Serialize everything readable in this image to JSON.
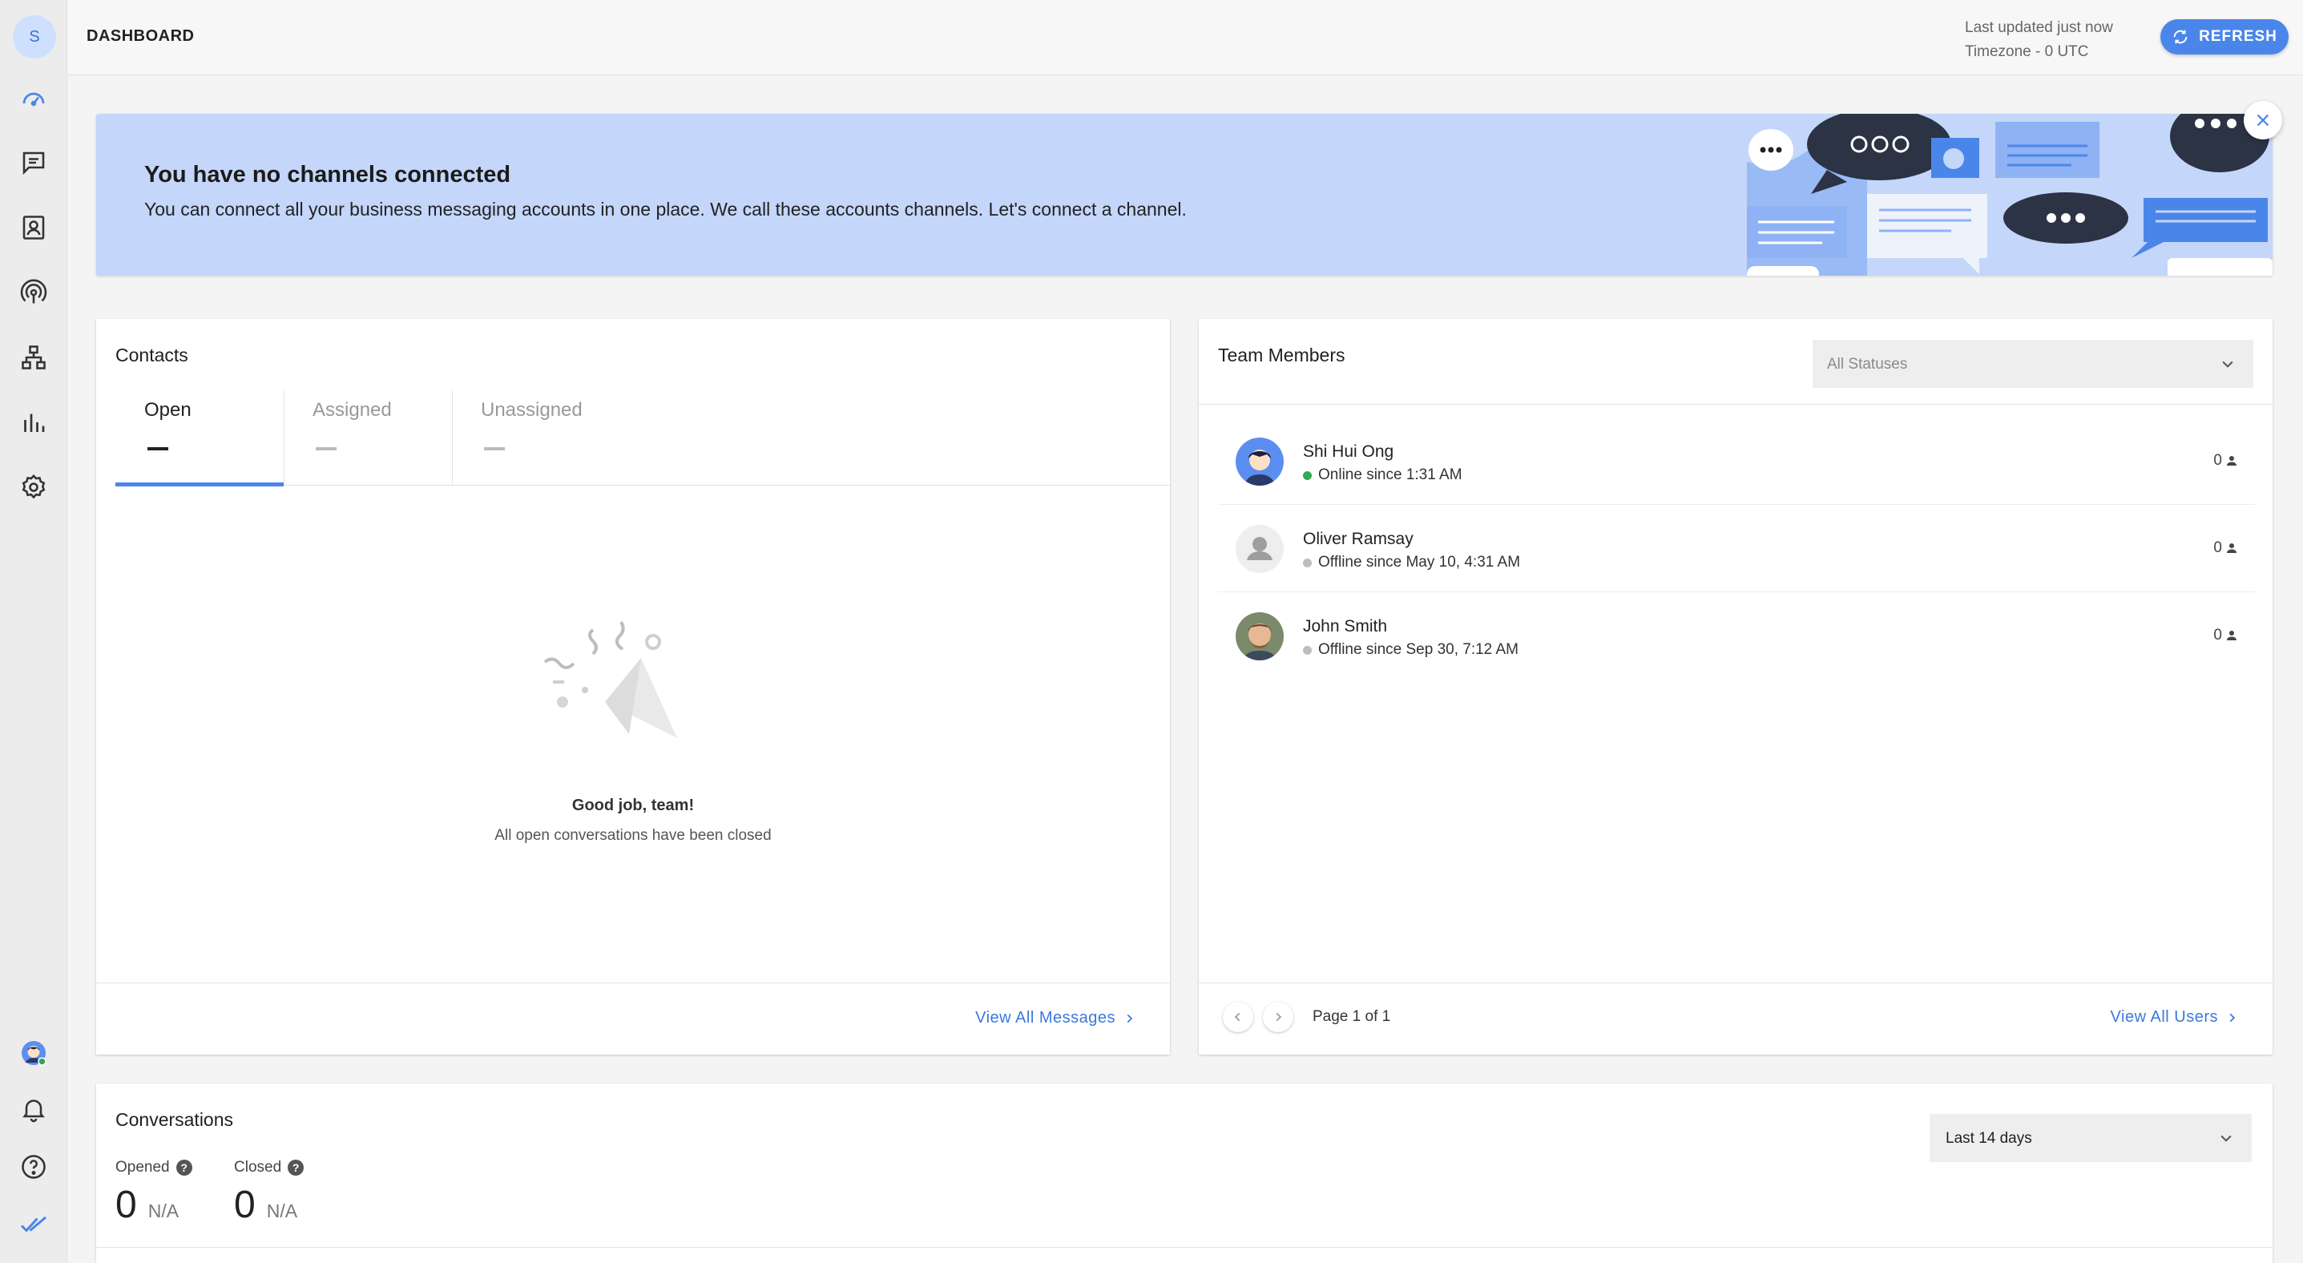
{
  "app": {
    "user_initial": "S",
    "page_title": "DASHBOARD",
    "last_updated": "Last updated just now",
    "timezone": "Timezone - 0 UTC",
    "refresh_label": "REFRESH",
    "accent_color": "#4a86ea"
  },
  "sidebar": {
    "items": [
      {
        "icon": "speedometer-icon",
        "active": true
      },
      {
        "icon": "message-icon"
      },
      {
        "icon": "contacts-icon"
      },
      {
        "icon": "broadcast-icon"
      },
      {
        "icon": "workflow-icon"
      },
      {
        "icon": "reports-icon"
      },
      {
        "icon": "settings-icon"
      }
    ],
    "bottom": [
      {
        "icon": "user-avatar-icon"
      },
      {
        "icon": "bell-icon"
      },
      {
        "icon": "help-icon"
      },
      {
        "icon": "double-check-logo-icon"
      }
    ]
  },
  "banner": {
    "title": "You have no channels connected",
    "text": "You can connect all your business messaging accounts in one place. We call these accounts channels. Let's connect a channel."
  },
  "contacts": {
    "title": "Contacts",
    "tabs": [
      {
        "label": "Open",
        "value": "—",
        "active": true
      },
      {
        "label": "Assigned",
        "value": "—",
        "active": false
      },
      {
        "label": "Unassigned",
        "value": "—",
        "active": false
      }
    ],
    "empty_title": "Good job, team!",
    "empty_subtitle": "All open conversations have been closed",
    "view_all": "View All Messages"
  },
  "team": {
    "title": "Team Members",
    "status_filter": "All Statuses",
    "members": [
      {
        "name": "Shi Hui Ong",
        "status": "Online since 1:31 AM",
        "online": true,
        "count": "0"
      },
      {
        "name": "Oliver Ramsay",
        "status": "Offline since May 10, 4:31 AM",
        "online": false,
        "count": "0"
      },
      {
        "name": "John Smith",
        "status": "Offline since Sep 30, 7:12 AM",
        "online": false,
        "count": "0"
      }
    ],
    "page": "Page 1 of 1",
    "view_all": "View All Users"
  },
  "conversations": {
    "title": "Conversations",
    "range": "Last 14 days",
    "metrics": [
      {
        "label": "Opened",
        "value": "0",
        "change": "N/A"
      },
      {
        "label": "Closed",
        "value": "0",
        "change": "N/A"
      }
    ]
  }
}
